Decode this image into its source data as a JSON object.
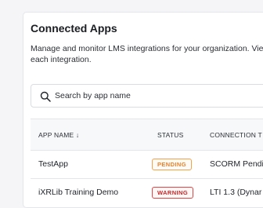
{
  "page": {
    "title": "Connected Apps",
    "description": "Manage and monitor LMS integrations for your organization. View each integration."
  },
  "search": {
    "placeholder": "Search by app name",
    "icon": "search-icon"
  },
  "table": {
    "columns": {
      "name": "APP NAME ↓",
      "status": "STATUS",
      "connection": "CONNECTION T"
    },
    "rows": [
      {
        "name": "TestApp",
        "status": "PENDING",
        "status_color": "#e9802a",
        "connection": "SCORM Pendi"
      },
      {
        "name": "iXRLib Training Demo",
        "status": "WARNING",
        "status_color": "#c62828",
        "connection": "LTI 1.3 (Dynar"
      }
    ]
  }
}
